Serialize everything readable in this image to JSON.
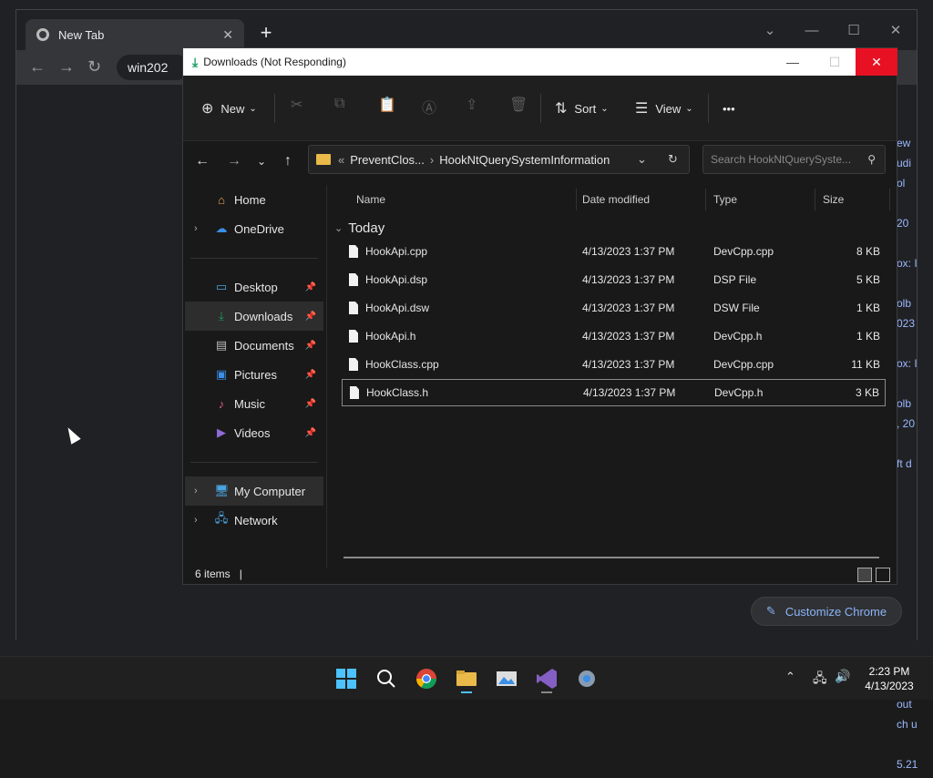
{
  "chrome": {
    "tab_title": "New Tab",
    "omnibox_text": "win202",
    "right_fragments": [
      "ew",
      "udi",
      "ol",
      "",
      "20",
      "",
      "ox: I",
      "",
      "olb",
      "023",
      "",
      "ox: I",
      "",
      "olb",
      ", 20",
      "",
      "ft d",
      "",
      "",
      "",
      "",
      "",
      "",
      "",
      "",
      "",
      "",
      "",
      "out",
      "ch u",
      "",
      "5.21"
    ],
    "customize_label": "Customize Chrome"
  },
  "explorer": {
    "title": "Downloads (Not Responding)",
    "commands": {
      "new": "New",
      "sort": "Sort",
      "view": "View",
      "more": "•••"
    },
    "address": {
      "parent": "PreventClos...",
      "current": "HookNtQuerySystemInformation"
    },
    "search_placeholder": "Search HookNtQuerySyste...",
    "sidebar": {
      "home": "Home",
      "onedrive": "OneDrive",
      "desktop": "Desktop",
      "downloads": "Downloads",
      "documents": "Documents",
      "pictures": "Pictures",
      "music": "Music",
      "videos": "Videos",
      "my_computer": "My Computer",
      "network": "Network"
    },
    "columns": {
      "name": "Name",
      "date": "Date modified",
      "type": "Type",
      "size": "Size"
    },
    "group": "Today",
    "files": [
      {
        "name": "HookApi.cpp",
        "date": "4/13/2023 1:37 PM",
        "type": "DevCpp.cpp",
        "size": "8 KB"
      },
      {
        "name": "HookApi.dsp",
        "date": "4/13/2023 1:37 PM",
        "type": "DSP File",
        "size": "5 KB"
      },
      {
        "name": "HookApi.dsw",
        "date": "4/13/2023 1:37 PM",
        "type": "DSW File",
        "size": "1 KB"
      },
      {
        "name": "HookApi.h",
        "date": "4/13/2023 1:37 PM",
        "type": "DevCpp.h",
        "size": "1 KB"
      },
      {
        "name": "HookClass.cpp",
        "date": "4/13/2023 1:37 PM",
        "type": "DevCpp.cpp",
        "size": "11 KB"
      },
      {
        "name": "HookClass.h",
        "date": "4/13/2023 1:37 PM",
        "type": "DevCpp.h",
        "size": "3 KB"
      }
    ],
    "status": "6 items"
  },
  "taskbar": {
    "time": "2:23 PM",
    "date": "4/13/2023"
  },
  "colors": {
    "close_red": "#e81123",
    "chrome_link": "#8ab4f8",
    "folder_yellow": "#e9b949"
  }
}
